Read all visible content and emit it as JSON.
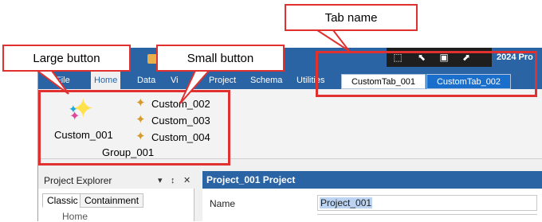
{
  "app": {
    "title_suffix": "2024 Pro",
    "ribbon_tabs": [
      "File",
      "Home",
      "Data",
      "Vi",
      "Project",
      "Schema",
      "Utilities"
    ],
    "custom_tabs": [
      "CustomTab_001",
      "CustomTab_002"
    ],
    "active_tab": "Home"
  },
  "ribbon": {
    "large_button_label": "Custom_001",
    "small_buttons": [
      "Custom_002",
      "Custom_003",
      "Custom_004"
    ],
    "group_label": "Group_001"
  },
  "explorer": {
    "title": "Project Explorer",
    "pin": "↕",
    "close": "✕",
    "dropdown": "▾",
    "tabs": [
      "Classic",
      "Containment"
    ],
    "home": "Home"
  },
  "main_panel": {
    "title": "Project_001 Project",
    "name_label": "Name",
    "name_value": "Project_001"
  },
  "annotations": {
    "large_button": "Large button",
    "small_button": "Small button",
    "tab_name": "Tab name"
  },
  "colors": {
    "accent": "#2a64a4",
    "callout_red": "#e03030",
    "selected_custom_tab": "#1a6fcc"
  }
}
